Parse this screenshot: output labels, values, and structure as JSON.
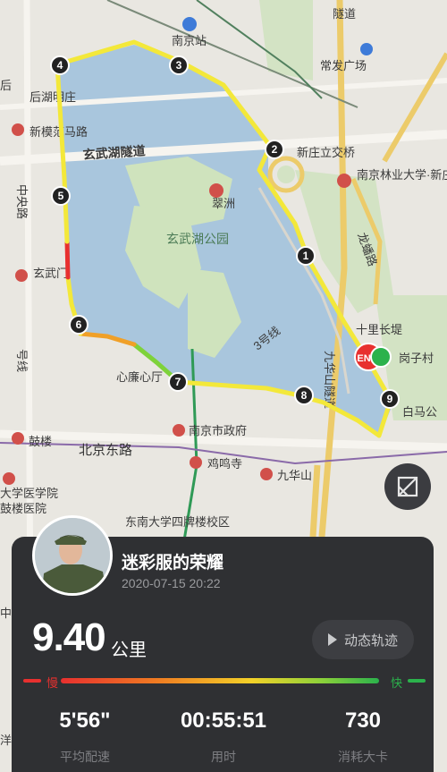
{
  "map": {
    "places": {
      "nanjing_station": "南京站",
      "changfa": "常发广场",
      "suidao_top": "隧道",
      "qiao_line": "新庄立交桥",
      "forestry_univ": "南京林业大学·新庄",
      "qinghuai": "后湖明庄",
      "xinmofan": "新模范马路",
      "xuanwu_tunnel": "玄武湖隧道",
      "zhongyang_lu": "中央路",
      "cuizhou": "翠洲",
      "xuanwu_park": "玄武湖公园",
      "xuanwumen": "玄武门",
      "longpan": "龙蟠路",
      "shili": "十里长堤",
      "lizi": "岗子村",
      "jiuhua_tunnel": "九华山隧道",
      "line3": "3号线",
      "xinlian": "心廉心厅",
      "gov": "南京市政府",
      "gulou": "鼓楼",
      "beijing_east": "北京东路",
      "jiming": "鸡鸣寺",
      "jiuhuashan": "九华山",
      "baima": "白马公",
      "med_univ": "大学医学院",
      "gulou_hosp": "鼓楼医院",
      "seu": "东南大学四牌楼校区",
      "hanxian": "号线",
      "zhong": "中",
      "yang": "洋",
      "hou": "后"
    },
    "km_markers": [
      "1",
      "2",
      "3",
      "4",
      "5",
      "6",
      "7",
      "8",
      "9"
    ],
    "end_label": "END"
  },
  "profile": {
    "name": "迷彩服的荣耀",
    "datetime": "2020-07-15 20:22"
  },
  "run": {
    "distance": "9.40",
    "distance_unit": "公里",
    "replay_label": "动态轨迹",
    "slow_label": "慢",
    "fast_label": "快",
    "pace": "5'56\"",
    "pace_label": "平均配速",
    "duration": "00:55:51",
    "duration_label": "用时",
    "calories": "730",
    "calories_label": "消耗大卡"
  },
  "colors": {
    "lake": "#a9c6dd",
    "park": "#cfe3bd",
    "route_yellow": "#f3e83a",
    "route_red": "#e8302f",
    "card_bg": "#2f3033"
  }
}
